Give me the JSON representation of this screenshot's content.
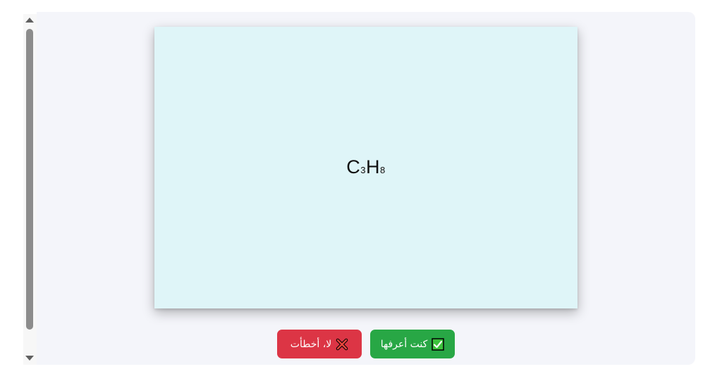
{
  "card": {
    "formula_base_1": "C",
    "formula_sub_1": "3",
    "formula_base_2": "H",
    "formula_sub_2": "8"
  },
  "buttons": {
    "wrong_label": "لا، أخطأت",
    "wrong_icon": "cross-mark-icon",
    "right_label": "كنت أعرفها",
    "right_icon": "check-box-icon"
  },
  "colors": {
    "card_background": "#dff5f8",
    "wrong_button": "#dc3545",
    "right_button": "#28a745",
    "panel_background": "#f4f5fa"
  }
}
